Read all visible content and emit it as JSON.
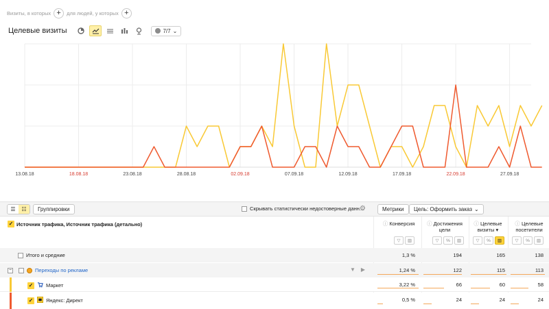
{
  "segments": {
    "visits_label": "Визиты, в которых",
    "people_label": "для людей, у которых",
    "plus": "+"
  },
  "header": {
    "title": "Целевые визиты",
    "series_count": "7/7"
  },
  "colors": {
    "series_market": "#f9c935",
    "series_direct": "#ef5a2f",
    "holiday_label": "#d63a2e",
    "accent": "#ffd33a"
  },
  "chart_data": {
    "type": "line",
    "x": [
      "13.08.18",
      "14.08.18",
      "15.08.18",
      "16.08.18",
      "17.08.18",
      "18.08.18",
      "19.08.18",
      "20.08.18",
      "21.08.18",
      "22.08.18",
      "23.08.18",
      "24.08.18",
      "25.08.18",
      "26.08.18",
      "27.08.18",
      "28.08.18",
      "29.08.18",
      "30.08.18",
      "31.08.18",
      "01.09.18",
      "02.09.18",
      "03.09.18",
      "04.09.18",
      "05.09.18",
      "06.09.18",
      "07.09.18",
      "08.09.18",
      "09.09.18",
      "10.09.18",
      "11.09.18",
      "12.09.18",
      "13.09.18",
      "14.09.18",
      "15.09.18",
      "16.09.18",
      "17.09.18",
      "18.09.18",
      "19.09.18",
      "20.09.18",
      "21.09.18",
      "22.09.18",
      "23.09.18",
      "24.09.18",
      "25.09.18",
      "26.09.18",
      "27.09.18",
      "28.09.18",
      "29.09.18"
    ],
    "tick_labels": [
      "13.08.18",
      "18.08.18",
      "23.08.18",
      "28.08.18",
      "02.09.18",
      "07.09.18",
      "12.09.18",
      "17.09.18",
      "22.09.18",
      "27.09.18"
    ],
    "red_ticks": [
      "18.08.18",
      "02.09.18",
      "22.09.18"
    ],
    "ylim": [
      0,
      6
    ],
    "grid": true,
    "series": [
      {
        "name": "Маркет",
        "color": "#f9c935",
        "values": [
          0,
          0,
          0,
          0,
          0,
          0,
          0,
          0,
          0,
          0,
          0,
          0,
          0,
          0,
          0,
          2,
          1,
          2,
          2,
          0,
          1,
          1,
          2,
          1,
          6,
          2,
          0,
          0,
          6,
          2,
          4,
          4,
          2,
          0,
          1,
          1,
          0,
          1,
          3,
          3,
          1,
          0,
          3,
          2,
          3,
          1,
          3,
          2,
          3
        ]
      },
      {
        "name": "Яндекс: Директ",
        "color": "#ef5a2f",
        "values": [
          0,
          0,
          0,
          0,
          0,
          0,
          0,
          0,
          0,
          0,
          0,
          0,
          1,
          0,
          0,
          0,
          0,
          0,
          0,
          0,
          1,
          1,
          2,
          0,
          0,
          0,
          1,
          1,
          0,
          2,
          1,
          1,
          0,
          0,
          1,
          2,
          2,
          0,
          0,
          0,
          4,
          0,
          0,
          0,
          1,
          0,
          2,
          0,
          0
        ]
      }
    ]
  },
  "table_toolbar": {
    "group_button": "Группировки",
    "hide_stats_label": "Скрывать статистически недостоверные данн...",
    "metrics_button": "Метрики",
    "goal_select": "Цель: Оформить заказ"
  },
  "table": {
    "dimension_header": "Источник трафика, Источник трафика (детально)",
    "columns": [
      {
        "label": "Конверсия"
      },
      {
        "label": "Достижения цели"
      },
      {
        "label": "Целевые визиты"
      },
      {
        "label": "Целевые посетители"
      }
    ],
    "rows": [
      {
        "label": "Итого и средние",
        "values": [
          "1,3 %",
          "194",
          "165",
          "138"
        ]
      },
      {
        "label": "Переходы по рекламе",
        "values": [
          "1,24 %",
          "122",
          "115",
          "113"
        ]
      },
      {
        "label": "Маркет",
        "values": [
          "3,22 %",
          "66",
          "60",
          "58"
        ]
      },
      {
        "label": "Яндекс: Директ",
        "values": [
          "0,5 %",
          "24",
          "24",
          "24"
        ]
      }
    ]
  }
}
